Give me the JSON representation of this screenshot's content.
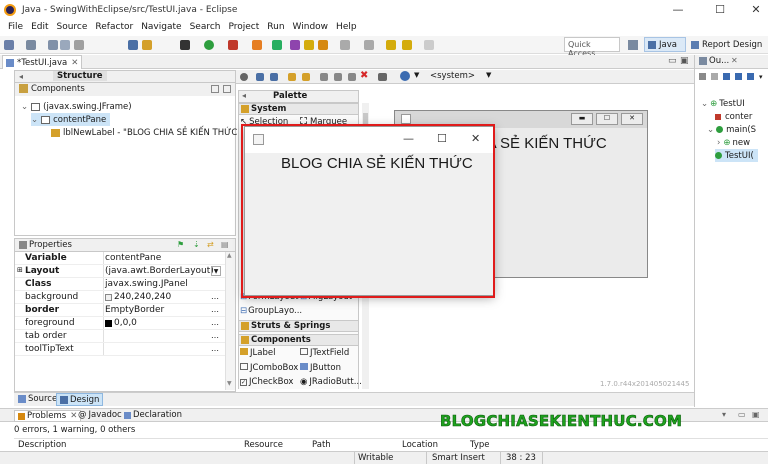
{
  "window": {
    "title": "Java - SwingWithEclipse/src/TestUI.java - Eclipse"
  },
  "menu": [
    "File",
    "Edit",
    "Source",
    "Refactor",
    "Navigate",
    "Search",
    "Project",
    "Run",
    "Window",
    "Help"
  ],
  "toolbar": {
    "quick_access": "Quick Access",
    "persp_java": "Java",
    "persp_report": "Report Design"
  },
  "editor_tab": "*TestUI.java",
  "structure": {
    "title": "Structure",
    "components_label": "Components",
    "tree": [
      "(javax.swing.JFrame)",
      "contentPane",
      "lblNewLabel - \"BLOG CHIA SẺ KIẾN THỨC\""
    ]
  },
  "properties": {
    "title": "Properties",
    "rows": [
      {
        "name": "Variable",
        "value": "contentPane"
      },
      {
        "name": "Layout",
        "value": "(java.awt.BorderLayout)"
      },
      {
        "name": "Class",
        "value": "javax.swing.JPanel"
      },
      {
        "name": "background",
        "value": "240,240,240"
      },
      {
        "name": "border",
        "value": "EmptyBorder"
      },
      {
        "name": "foreground",
        "value": "0,0,0"
      },
      {
        "name": "tab order",
        "value": ""
      },
      {
        "name": "toolTipText",
        "value": ""
      }
    ]
  },
  "palette": {
    "title": "Palette",
    "system": "System",
    "selection": "Selection",
    "marquee": "Marquee",
    "formlayout": "FormLayout",
    "miglayout": "MigLayout",
    "grouplayout": "GroupLayo...",
    "struts": "Struts & Springs",
    "components": "Components",
    "items": [
      "JLabel",
      "JTextField",
      "JComboBox",
      "JButton",
      "JCheckBox",
      "JRadioButt..."
    ]
  },
  "designer": {
    "system_combo": "<system>",
    "version": "1.7.0.r44x201405021445",
    "label_text": "BLOG CHIA SẺ KIẾN THỨC"
  },
  "preview": {
    "label": "BLOG CHIA SẺ KIẾN THỨC"
  },
  "bottom_tabs": {
    "source": "Source",
    "design": "Design"
  },
  "outline": {
    "title": "Ou...",
    "items": [
      "TestUI",
      "conter",
      "main(S",
      "new",
      "TestUI("
    ]
  },
  "problems": {
    "tabs": [
      "Problems",
      "Javadoc",
      "Declaration"
    ],
    "summary": "0 errors, 1 warning, 0 others",
    "columns": [
      "Description",
      "Resource",
      "Path",
      "Location",
      "Type"
    ]
  },
  "watermark": "BLOGCHIASEKIENTHUC.COM",
  "status": {
    "writable": "Writable",
    "insert": "Smart Insert",
    "position": "38 : 23"
  }
}
